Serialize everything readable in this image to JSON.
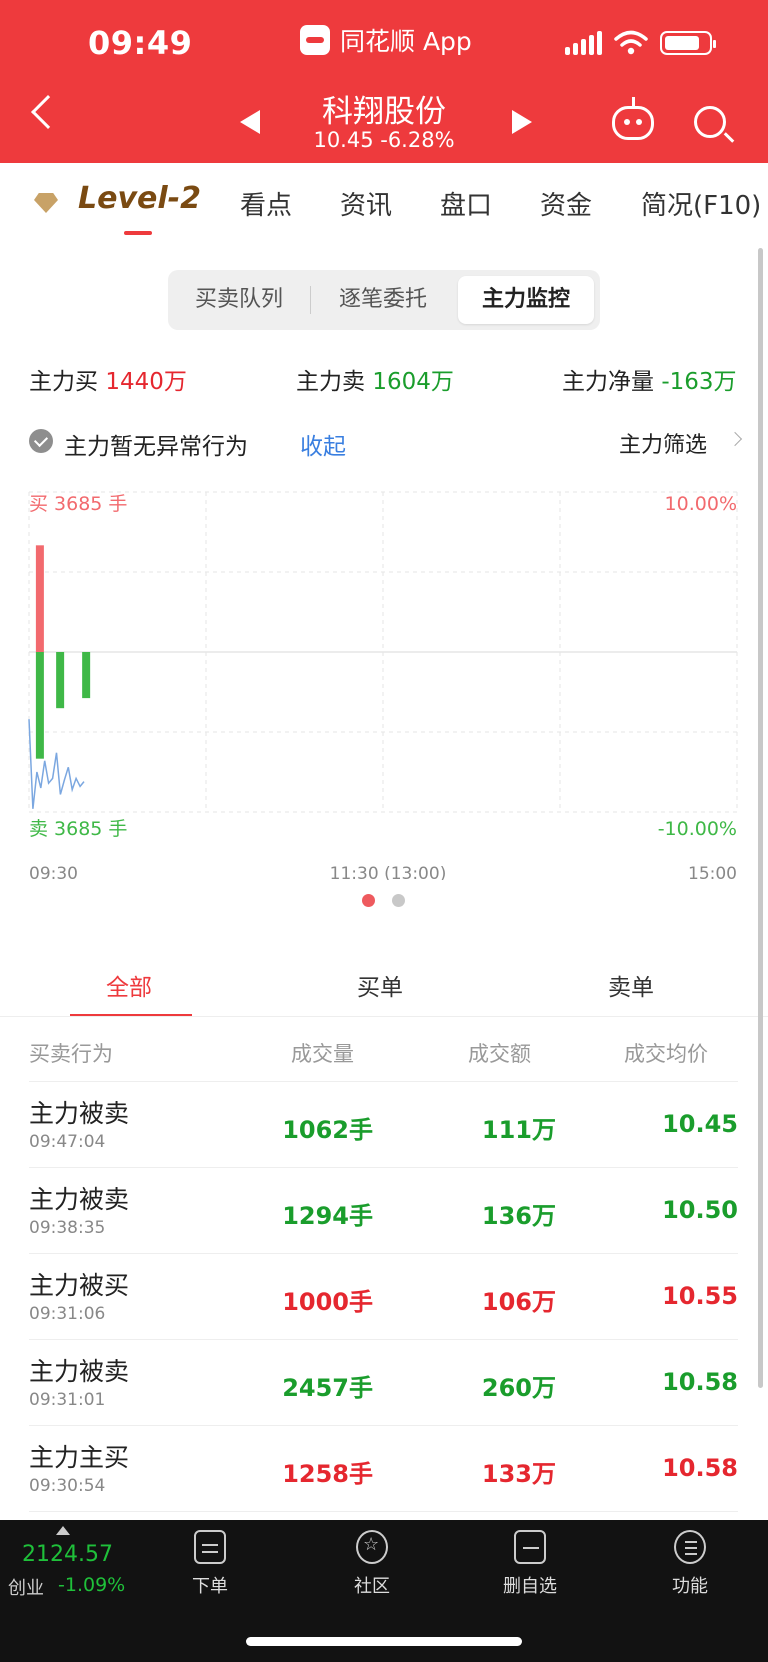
{
  "status_bar": {
    "time": "09:49",
    "app_name": "同花顺 App"
  },
  "stock": {
    "name": "科翔股份",
    "price_line": "10.45 -6.28%"
  },
  "tabs": [
    "Level-2",
    "看点",
    "资讯",
    "盘口",
    "资金",
    "简况(F10)"
  ],
  "segments": [
    "买卖队列",
    "逐笔委托",
    "主力监控"
  ],
  "summary": {
    "buy_label": "主力买",
    "buy_value": "1440万",
    "sell_label": "主力卖",
    "sell_value": "1604万",
    "net_label": "主力净量",
    "net_value": "-163万"
  },
  "alert": {
    "text": "主力暂无异常行为",
    "collapse": "收起",
    "filter": "主力筛选"
  },
  "chart_data": {
    "type": "bar",
    "buy_label": "买 3685 手",
    "sell_label": "卖 3685 手",
    "y_top": "10.00%",
    "y_bottom": "-10.00%",
    "x_ticks": [
      "09:30",
      "11:30 (13:00)",
      "15:00"
    ],
    "bars": [
      {
        "time": "09:31",
        "value": 2457,
        "side": "buy"
      },
      {
        "time": "09:31",
        "value": -2457,
        "side": "sell"
      },
      {
        "time": "09:38",
        "value": -1294,
        "side": "sell"
      },
      {
        "time": "09:47",
        "value": -1062,
        "side": "sell"
      }
    ],
    "price_line_pct": [
      -4.2,
      -9.8,
      -7.5,
      -8.5,
      -6.8,
      -8.2,
      -7.9,
      -6.3,
      -8.9,
      -8.0,
      -7.2,
      -8.6,
      -7.9,
      -8.4,
      -8.1
    ],
    "colors": {
      "buy": "#f26a6e",
      "sell": "#3fb847",
      "line": "#7ba7e0"
    }
  },
  "sub_tabs": [
    "全部",
    "买单",
    "卖单"
  ],
  "table": {
    "headers": [
      "买卖行为",
      "成交量",
      "成交额",
      "成交均价"
    ],
    "rows": [
      {
        "action": "主力被卖",
        "time": "09:47:04",
        "volume": "1062手",
        "amount": "111万",
        "avg": "10.45",
        "side": "sell"
      },
      {
        "action": "主力被卖",
        "time": "09:38:35",
        "volume": "1294手",
        "amount": "136万",
        "avg": "10.50",
        "side": "sell"
      },
      {
        "action": "主力被买",
        "time": "09:31:06",
        "volume": "1000手",
        "amount": "106万",
        "avg": "10.55",
        "side": "buy"
      },
      {
        "action": "主力被卖",
        "time": "09:31:01",
        "volume": "2457手",
        "amount": "260万",
        "avg": "10.58",
        "side": "sell"
      },
      {
        "action": "主力主买",
        "time": "09:30:54",
        "volume": "1258手",
        "amount": "133万",
        "avg": "10.58",
        "side": "buy"
      }
    ]
  },
  "bottom_bar": {
    "index_value": "2124.57",
    "index_name": "创业",
    "index_change": "-1.09%",
    "nav": [
      "下单",
      "社区",
      "删自选",
      "功能"
    ]
  },
  "colors": {
    "header": "#ee3a3d",
    "up": "#e5272f",
    "down": "#1a9d2c"
  }
}
